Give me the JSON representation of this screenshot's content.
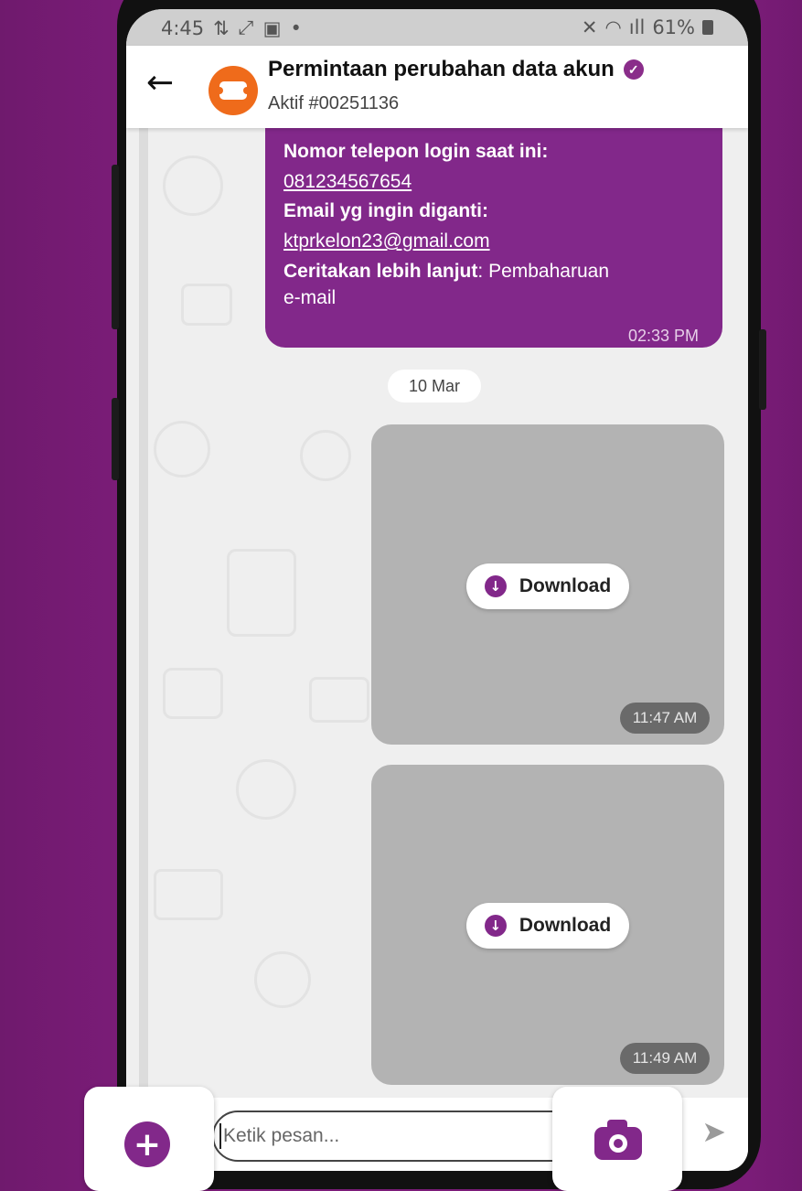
{
  "status_bar": {
    "time": "4:45",
    "battery": "61%"
  },
  "header": {
    "title": "Permintaan perubahan data akun",
    "subtitle": "Aktif #00251136"
  },
  "messages": {
    "outgoing_text": {
      "label_phone": "Nomor telepon login saat ini:",
      "phone": "081234567654",
      "label_email": "Email yg ingin diganti:",
      "email": "ktprkelon23@gmail.com",
      "label_more": "Ceritakan lebih lanjut",
      "more_sep": ":",
      "more_value_1": " Pembaharuan",
      "more_value_2": "e-mail",
      "time": "02:33 PM"
    },
    "date_divider": "10 Mar",
    "attachments": [
      {
        "button_label": "Download",
        "time": "11:47 AM"
      },
      {
        "button_label": "Download",
        "time": "11:49 AM"
      }
    ]
  },
  "composer": {
    "placeholder": "Ketik pesan..."
  },
  "colors": {
    "brand_purple": "#82288a",
    "background_purple": "#7b1c78",
    "avatar_orange": "#ef6b1b"
  },
  "icons": {
    "back": "arrow-left-icon",
    "verified": "verified-badge-icon",
    "download": "download-icon",
    "send": "send-icon",
    "add": "plus-icon",
    "camera": "camera-icon"
  }
}
